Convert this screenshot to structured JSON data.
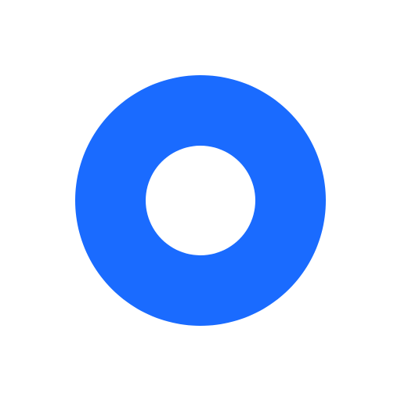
{
  "icon": {
    "name": "ring-icon",
    "shape": "ring",
    "color": "#1a6bff",
    "background": "#ffffff"
  }
}
